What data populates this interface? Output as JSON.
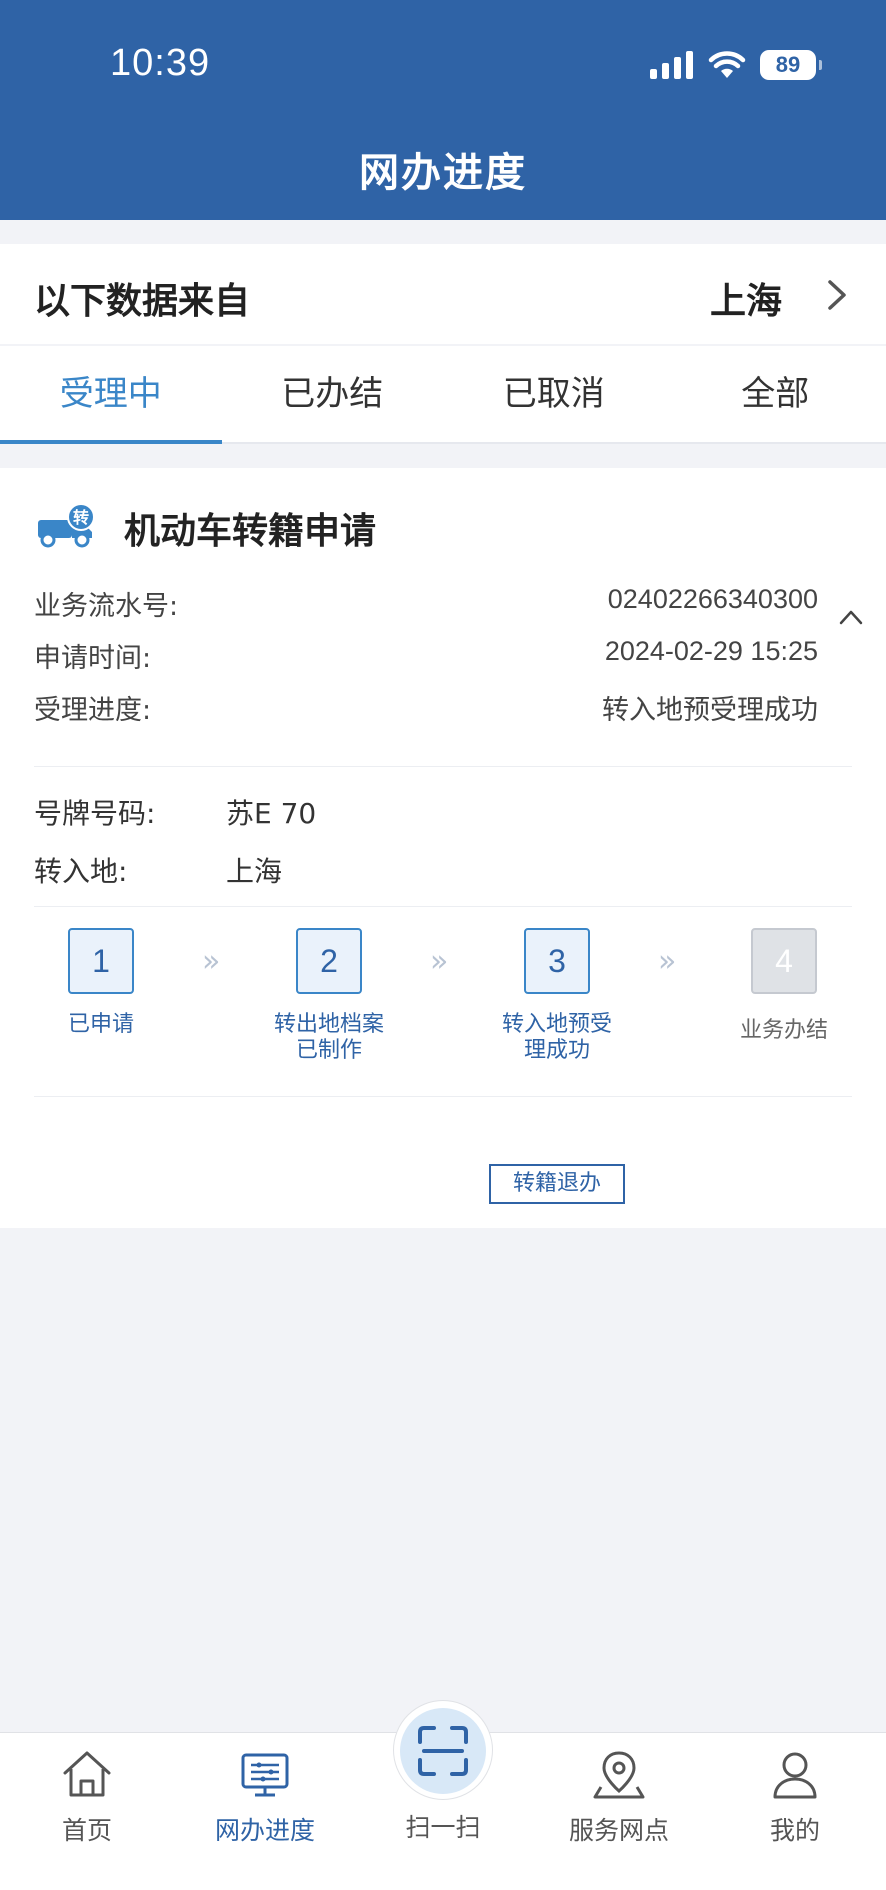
{
  "status_bar": {
    "time": "10:39",
    "battery": "89"
  },
  "header": {
    "title": "网办进度"
  },
  "source": {
    "label": "以下数据来自",
    "city": "上海"
  },
  "tabs": [
    {
      "label": "受理中",
      "active": true
    },
    {
      "label": "已办结",
      "active": false
    },
    {
      "label": "已取消",
      "active": false
    },
    {
      "label": "全部",
      "active": false
    }
  ],
  "card": {
    "icon_badge": "转",
    "title": "机动车转籍申请",
    "info": [
      {
        "label": "业务流水号:",
        "value": "02402266340300"
      },
      {
        "label": "申请时间:",
        "value": "2024-02-29 15:25"
      },
      {
        "label": "受理进度:",
        "value": "转入地预受理成功"
      }
    ],
    "plate": {
      "label": "号牌号码:",
      "value": "苏E  70"
    },
    "destination": {
      "label": "转入地:",
      "value": "上海"
    },
    "steps": [
      {
        "num": "1",
        "label": "已申请",
        "done": true
      },
      {
        "num": "2",
        "label": "转出地档案已制作",
        "done": true
      },
      {
        "num": "3",
        "label": "转入地预受理成功",
        "done": true
      },
      {
        "num": "4",
        "label": "业务办结",
        "done": false
      }
    ],
    "step_separator": "»",
    "action_label": "转籍退办"
  },
  "bottom_nav": [
    {
      "label": "首页",
      "icon": "home-icon"
    },
    {
      "label": "网办进度",
      "icon": "monitor-icon",
      "active": true
    },
    {
      "label": "扫一扫",
      "icon": "scan-icon"
    },
    {
      "label": "服务网点",
      "icon": "map-pin-icon"
    },
    {
      "label": "我的",
      "icon": "user-icon"
    }
  ],
  "colors": {
    "primary": "#2f63a6",
    "accent": "#3a86c8",
    "background": "#f2f3f7"
  }
}
